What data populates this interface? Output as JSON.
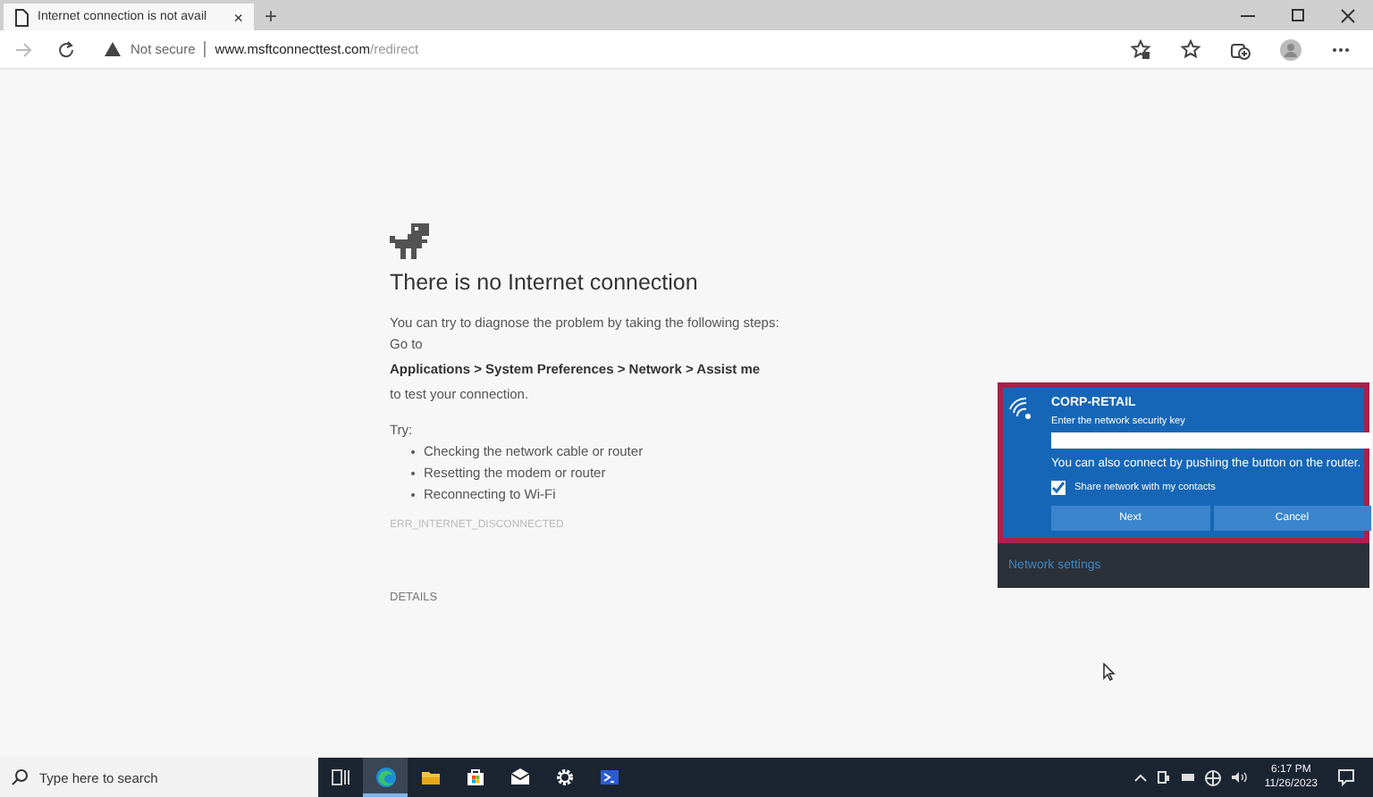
{
  "browser": {
    "tab": {
      "title": "Internet connection is not avail",
      "close": "×",
      "selected": true
    },
    "new_tab": "+",
    "address": {
      "security": "Not secure",
      "host": "www.msftconnecttest.com",
      "path": "/redirect"
    }
  },
  "page": {
    "heading": "There is no Internet connection",
    "intro": "You can try to diagnose the problem by taking the following steps:",
    "go_to": "Go to",
    "steps_path": "Applications > System Preferences > Network > Assist me",
    "test": "to test your connection.",
    "try_label": "Try:",
    "suggestions": [
      "Checking the network cable or router",
      "Resetting the modem or router",
      "Reconnecting to Wi-Fi"
    ],
    "error_code": "ERR_INTERNET_DISCONNECTED",
    "details": "DETAILS"
  },
  "wifi_flyout": {
    "network_name": "CORP-RETAIL",
    "prompt": "Enter the network security key",
    "hint": "You can also connect by pushing the button on the router.",
    "share": {
      "label": "Share network with my contacts",
      "checked": true
    },
    "buttons": [
      "Next",
      "Cancel"
    ],
    "footer_link": "Network settings"
  },
  "taskbar": {
    "search_placeholder": "Type here to search",
    "apps": [
      {
        "kind": "taskview",
        "selected": false
      },
      {
        "kind": "edge",
        "selected": true
      },
      {
        "kind": "explorer",
        "selected": false
      },
      {
        "kind": "store",
        "selected": false
      },
      {
        "kind": "mail",
        "selected": false
      },
      {
        "kind": "settings",
        "selected": false
      },
      {
        "kind": "terminal",
        "selected": false
      }
    ],
    "time": "6:17 PM",
    "date": "11/26/2023"
  }
}
